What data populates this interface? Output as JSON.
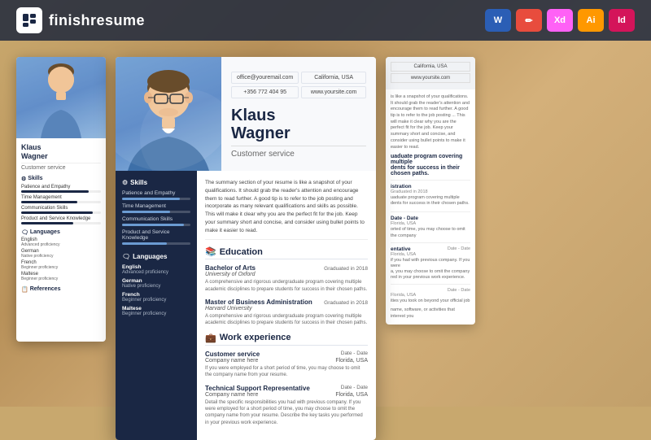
{
  "brand": {
    "name": "finishresume",
    "logo_alt": "finishresume logo"
  },
  "formats": [
    {
      "label": "W",
      "type": "word",
      "class": "badge-word"
    },
    {
      "label": "✏",
      "type": "pen",
      "class": "badge-pen"
    },
    {
      "label": "Xd",
      "type": "xd",
      "class": "badge-xd"
    },
    {
      "label": "Ai",
      "type": "ai",
      "class": "badge-ai"
    },
    {
      "label": "Id",
      "type": "id",
      "class": "badge-id"
    }
  ],
  "person": {
    "first_name": "Klaus",
    "last_name": "Wagner",
    "full_name": "Klaus Wagner",
    "job_title": "Customer service"
  },
  "contact": {
    "email": "office@youremail.com",
    "phone": "+356 772 404 95",
    "location": "California, USA",
    "website": "www.yoursite.com"
  },
  "summary": "The summary section of your resume is like a snapshot of your qualifications. It should grab the reader's attention and encourage them to read further. A good tip is to refer to the job posting and incorporate as many relevant qualifications and skills as possible. This will make it clear why you are the perfect fit for the job. Keep your summary short and concise, and consider using bullet points to make it easier to read.",
  "skills": [
    {
      "name": "Patience and Empathy",
      "level": 85
    },
    {
      "name": "Time Management",
      "level": 70
    },
    {
      "name": "Communication Skills",
      "level": 90
    },
    {
      "name": "Product and Service Knowledge",
      "level": 65
    }
  ],
  "languages": [
    {
      "name": "English",
      "level": "Advanced proficiency"
    },
    {
      "name": "German",
      "level": "Native proficiency"
    },
    {
      "name": "French",
      "level": "Beginner proficiency"
    },
    {
      "name": "Maltese",
      "level": "Beginner proficiency"
    }
  ],
  "education": [
    {
      "degree": "Bachelor of Arts",
      "university": "University of Oxford",
      "year": "Graduated in 2018",
      "description": "A comprehensive and rigorous undergraduate program covering multiple academic disciplines to prepare students for success in their chosen paths."
    },
    {
      "degree": "Master of Business Administration",
      "university": "Harvard University",
      "year": "Graduated in 2018",
      "description": "A comprehensive and rigorous undergraduate program covering multiple academic disciplines to prepare students for success in their chosen paths."
    }
  ],
  "work_experience": [
    {
      "title": "Customer service",
      "company": "Company name here",
      "location": "Florida, USA",
      "date": "Date - Date",
      "description": "If you were employed for a short period of time, you may choose to omit the company name from your resume."
    },
    {
      "title": "Technical Support Representative",
      "company": "Company name here",
      "location": "Florida, USA",
      "date": "Date - Date",
      "description": "Detail the specific responsibilities you had with previous company. If you were employed for a short period of time, you may choose to omit the company name from your resume. Describe the key tasks you performed in your previous work experience."
    }
  ],
  "sections": {
    "skills_label": "Skills",
    "languages_label": "Languages",
    "references_label": "References",
    "education_label": "Education",
    "work_label": "Work experience"
  }
}
